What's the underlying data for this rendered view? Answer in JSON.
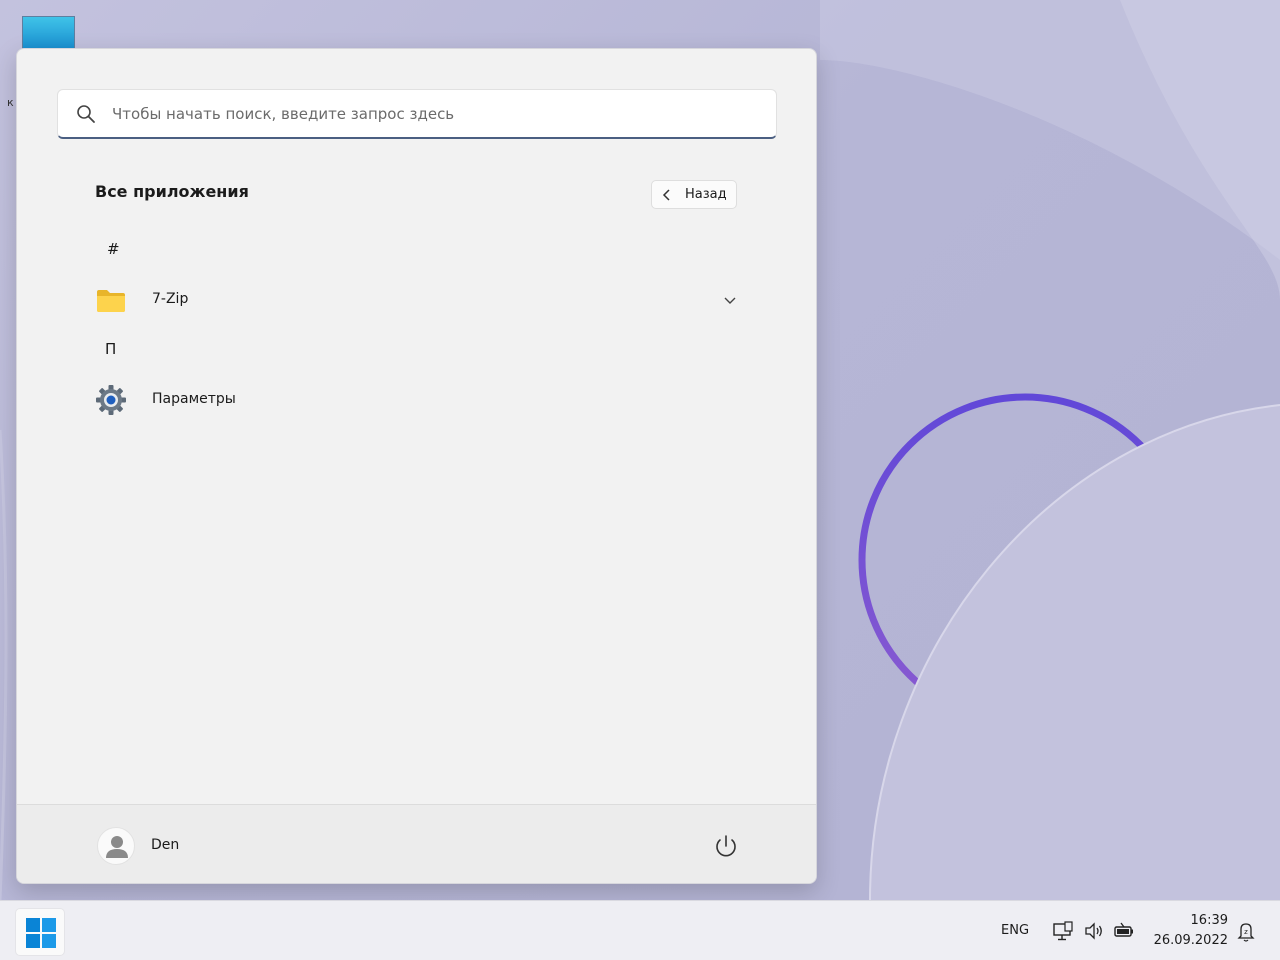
{
  "start_menu": {
    "search": {
      "placeholder": "Чтобы начать поиск, введите запрос здесь",
      "value": ""
    },
    "section_title": "Все приложения",
    "back_button_label": "Назад",
    "groups": [
      {
        "letter": "#",
        "apps": [
          {
            "name": "7-Zip",
            "icon": "folder-icon",
            "expandable": true
          }
        ]
      },
      {
        "letter": "П",
        "apps": [
          {
            "name": "Параметры",
            "icon": "gear-icon",
            "expandable": false
          }
        ]
      }
    ],
    "footer": {
      "user_name": "Den",
      "power_icon": "power-icon"
    }
  },
  "taskbar": {
    "start_icon": "windows-logo-icon",
    "language": "ENG",
    "tray_icons": [
      "network-icon",
      "volume-icon",
      "battery-icon"
    ],
    "time": "16:39",
    "date": "26.09.2022",
    "notification_icon": "notification-icon"
  },
  "colors": {
    "accent": "#4b5f82",
    "ring": "#6a52cf",
    "windows_blue": "#0a84d6"
  }
}
